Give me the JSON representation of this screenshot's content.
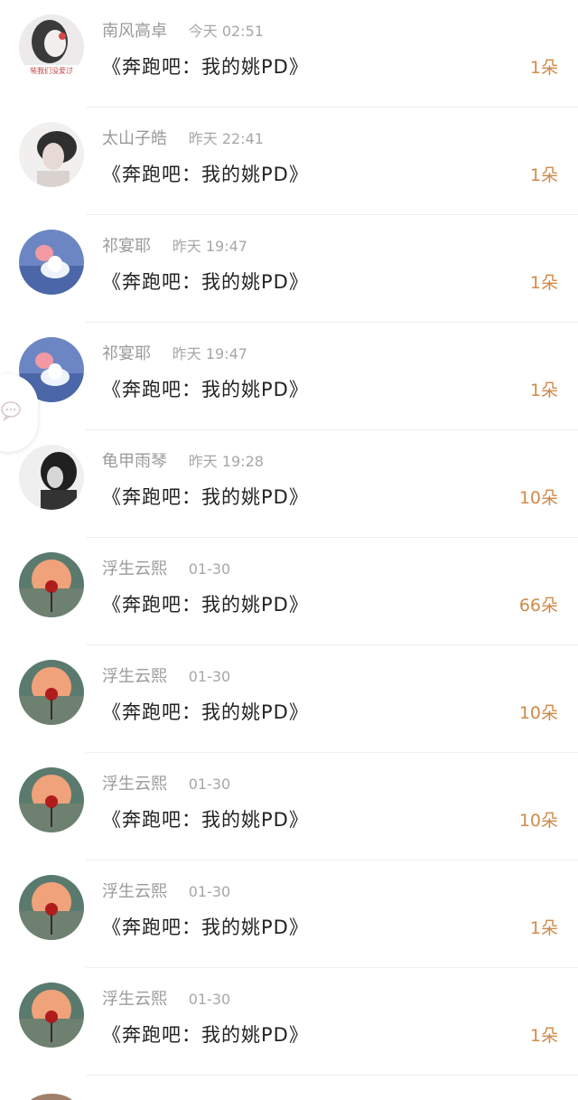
{
  "items": [
    {
      "name": "南风高卓",
      "time": "今天 02:51",
      "title": "《奔跑吧：我的姚PD》",
      "count": "1朵",
      "avatar": "bw-girl-avatar",
      "avatar_caption": "装我们没爱过"
    },
    {
      "name": "太山子皓",
      "time": "昨天 22:41",
      "title": "《奔跑吧：我的姚PD》",
      "count": "1朵",
      "avatar": "portrait-avatar"
    },
    {
      "name": "祁宴耶",
      "time": "昨天 19:47",
      "title": "《奔跑吧：我的姚PD》",
      "count": "1朵",
      "avatar": "lotus-avatar"
    },
    {
      "name": "祁宴耶",
      "time": "昨天 19:47",
      "title": "《奔跑吧：我的姚PD》",
      "count": "1朵",
      "avatar": "lotus-avatar"
    },
    {
      "name": "龟甲雨琴",
      "time": "昨天 19:28",
      "title": "《奔跑吧：我的姚PD》",
      "count": "10朵",
      "avatar": "bw-portrait-avatar"
    },
    {
      "name": "浮生云熙",
      "time": "01-30",
      "title": "《奔跑吧：我的姚PD》",
      "count": "66朵",
      "avatar": "rose-sunset-avatar"
    },
    {
      "name": "浮生云熙",
      "time": "01-30",
      "title": "《奔跑吧：我的姚PD》",
      "count": "10朵",
      "avatar": "rose-sunset-avatar"
    },
    {
      "name": "浮生云熙",
      "time": "01-30",
      "title": "《奔跑吧：我的姚PD》",
      "count": "10朵",
      "avatar": "rose-sunset-avatar"
    },
    {
      "name": "浮生云熙",
      "time": "01-30",
      "title": "《奔跑吧：我的姚PD》",
      "count": "1朵",
      "avatar": "rose-sunset-avatar"
    },
    {
      "name": "浮生云熙",
      "time": "01-30",
      "title": "《奔跑吧：我的姚PD》",
      "count": "1朵",
      "avatar": "rose-sunset-avatar"
    }
  ],
  "floating_button": {
    "icon": "chat-bubble-icon"
  },
  "colors": {
    "count": "#d08a4a",
    "name": "#9a9a9a",
    "title": "#222222"
  }
}
